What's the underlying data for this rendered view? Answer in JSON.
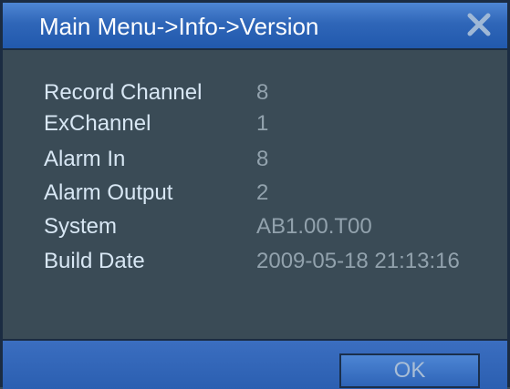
{
  "window": {
    "title": "Main Menu->Info->Version"
  },
  "info_rows": [
    {
      "label": "Record Channel",
      "value": "8"
    },
    {
      "label": "ExChannel",
      "value": "1"
    },
    {
      "label": "Alarm In",
      "value": "8"
    },
    {
      "label": "Alarm Output",
      "value": "2"
    },
    {
      "label": "System",
      "value": "AB1.00.T00"
    },
    {
      "label": "Build Date",
      "value": "2009-05-18 21:13:16"
    }
  ],
  "footer": {
    "ok_label": "OK"
  },
  "colors": {
    "title_bar": "#2f66b8",
    "panel": "#3a4b56",
    "label_text": "#d8e7f4",
    "value_text": "#92a2ad"
  },
  "icons": {
    "close": "close-icon"
  }
}
